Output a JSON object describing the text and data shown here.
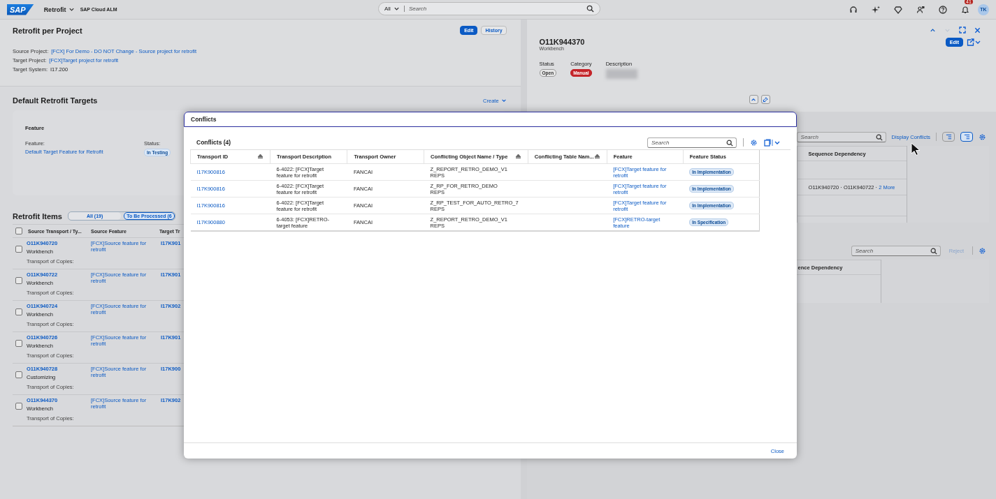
{
  "shell": {
    "logo": "SAP",
    "app": "Retrofit",
    "product": "SAP Cloud ALM",
    "search_scope": "All",
    "search_placeholder": "Search",
    "notification_count": "41",
    "avatar": "TK"
  },
  "project": {
    "title": "Retrofit per Project",
    "actions": [
      {
        "label": "Edit",
        "kind": "primary"
      },
      {
        "label": "History",
        "kind": "secondary"
      }
    ],
    "fields": [
      {
        "label": "Source Project:",
        "value": "[FCX] For Demo - DO NOT Change - Source project for retrofit",
        "kind": "link"
      },
      {
        "label": "Target Project:",
        "value": "[FCX]Target project for retrofit",
        "kind": "link"
      },
      {
        "label": "Target System:",
        "value": "I17.200",
        "kind": "text"
      }
    ]
  },
  "targets": {
    "title": "Default Retrofit Targets",
    "create": "Create",
    "card_title": "Feature",
    "feature_label": "Feature:",
    "feature_value": "Default Target Feature for Retrofit",
    "status_label": "Status:",
    "status_value": "In Testing"
  },
  "items": {
    "title": "Retrofit Items",
    "filters": [
      {
        "label": "All (19)",
        "selected": false
      },
      {
        "label": "To Be Processed (6",
        "selected": true
      }
    ],
    "select_all_checked": false,
    "columns": [
      "Source Transport / Ty...",
      "Source Feature",
      "Target Tr"
    ],
    "rows": [
      {
        "transport": "O11K940720",
        "type": "Workbench",
        "copies": "Transport of Copies:",
        "feature": "[FCX]Source feature for retrofit",
        "target": "I17K901",
        "checked": false
      },
      {
        "transport": "O11K940722",
        "type": "Workbench",
        "copies": "Transport of Copies:",
        "feature": "[FCX]Source feature for retrofit",
        "target": "I17K901",
        "checked": false
      },
      {
        "transport": "O11K940724",
        "type": "Workbench",
        "copies": "Transport of Copies:",
        "feature": "[FCX]Source feature for retrofit",
        "target": "I17K902",
        "checked": false
      },
      {
        "transport": "O11K940726",
        "type": "Workbench",
        "copies": "Transport of Copies:",
        "feature": "[FCX]Source feature for retrofit",
        "target": "I17K901",
        "checked": false
      },
      {
        "transport": "O11K940728",
        "type": "Customizing",
        "copies": "Transport of Copies:",
        "feature": "[FCX]Source feature for retrofit",
        "target": "I17K900",
        "checked": false
      },
      {
        "transport": "O11K944370",
        "type": "Workbench",
        "copies": "Transport of Copies:",
        "feature": "[FCX]Source feature for retrofit",
        "target": "I17K902",
        "checked": false
      }
    ]
  },
  "detail": {
    "title": "O11K944370",
    "subtitle": "Workbench",
    "edit": "Edit",
    "nav": [
      {
        "kind": "up",
        "disabled": false
      },
      {
        "kind": "down",
        "disabled": true
      }
    ],
    "attributes": [
      {
        "label": "Status",
        "value": "Open",
        "kind": "neutral"
      },
      {
        "label": "Category",
        "value": "Manual",
        "kind": "error"
      },
      {
        "label": "Description",
        "kind": "blurred"
      }
    ],
    "upper": {
      "search_placeholder": "Search",
      "action": "Display Conflicts",
      "view_toggles": [
        {
          "selected": false
        },
        {
          "selected": true
        }
      ],
      "column": "Sequence Dependency",
      "dependency": "O11K940720 · O11K940722 · ",
      "more": "2 More"
    },
    "lower": {
      "search_placeholder": "Search",
      "action": {
        "label": "Reject",
        "disabled": true
      },
      "column": "ence Dependency"
    }
  },
  "dialog": {
    "title": "Conflicts",
    "table_title": "Conflicts (4)",
    "search_placeholder": "Search",
    "columns": [
      {
        "label": "Transport ID",
        "sortable": true
      },
      {
        "label": "Transport Description",
        "sortable": false
      },
      {
        "label": "Transport Owner",
        "sortable": false
      },
      {
        "label": "Conflicting Object Name / Type",
        "sortable": true
      },
      {
        "label": "Conflicting Table Nam...",
        "sortable": true
      },
      {
        "label": "Feature",
        "sortable": false
      },
      {
        "label": "Feature Status",
        "sortable": false
      }
    ],
    "rows": [
      {
        "transport": "I17K900816",
        "description": "6-4022: [FCX]Target feature for retrofit",
        "owner": "FANCAI",
        "object": "Z_REPORT_RETRO_DEMO_V1",
        "object_type": "REPS",
        "feature": "[FCX]Target feature for retrofit",
        "status": "In Implementation"
      },
      {
        "transport": "I17K900816",
        "description": "6-4022: [FCX]Target feature for retrofit",
        "owner": "FANCAI",
        "object": "Z_RP_FOR_RETRO_DEMO",
        "object_type": "REPS",
        "feature": "[FCX]Target feature for retrofit",
        "status": "In Implementation"
      },
      {
        "transport": "I17K900816",
        "description": "6-4022: [FCX]Target feature for retrofit",
        "owner": "FANCAI",
        "object": "Z_RP_TEST_FOR_AUTO_RETRO_7",
        "object_type": "REPS",
        "feature": "[FCX]Target feature for retrofit",
        "status": "In Implementation"
      },
      {
        "transport": "I17K900880",
        "description": "6-4053: [FCX]RETRO-target feature",
        "owner": "FANCAI",
        "object": "Z_REPORT_RETRO_DEMO_V1",
        "object_type": "REPS",
        "feature": "[FCX]RETRO-target feature",
        "status": "In Specification"
      }
    ],
    "close": "Close"
  }
}
